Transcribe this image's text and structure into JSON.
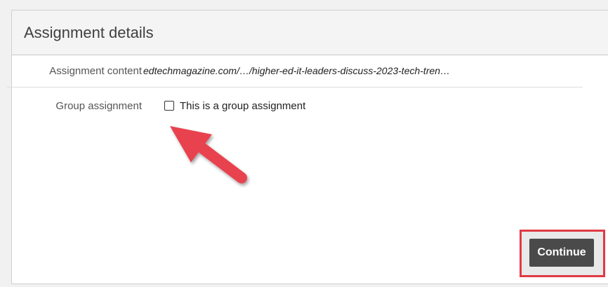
{
  "panel": {
    "title": "Assignment details"
  },
  "fields": {
    "content": {
      "label": "Assignment content",
      "value": "edtechmagazine.com/…/higher-ed-it-leaders-discuss-2023-tech-tren…"
    },
    "group": {
      "label": "Group assignment",
      "checkbox_label": "This is a group assignment",
      "checked": false
    }
  },
  "actions": {
    "continue_label": "Continue"
  },
  "annotations": {
    "arrow_color": "#e8434f",
    "highlight_color": "#e03a45"
  }
}
